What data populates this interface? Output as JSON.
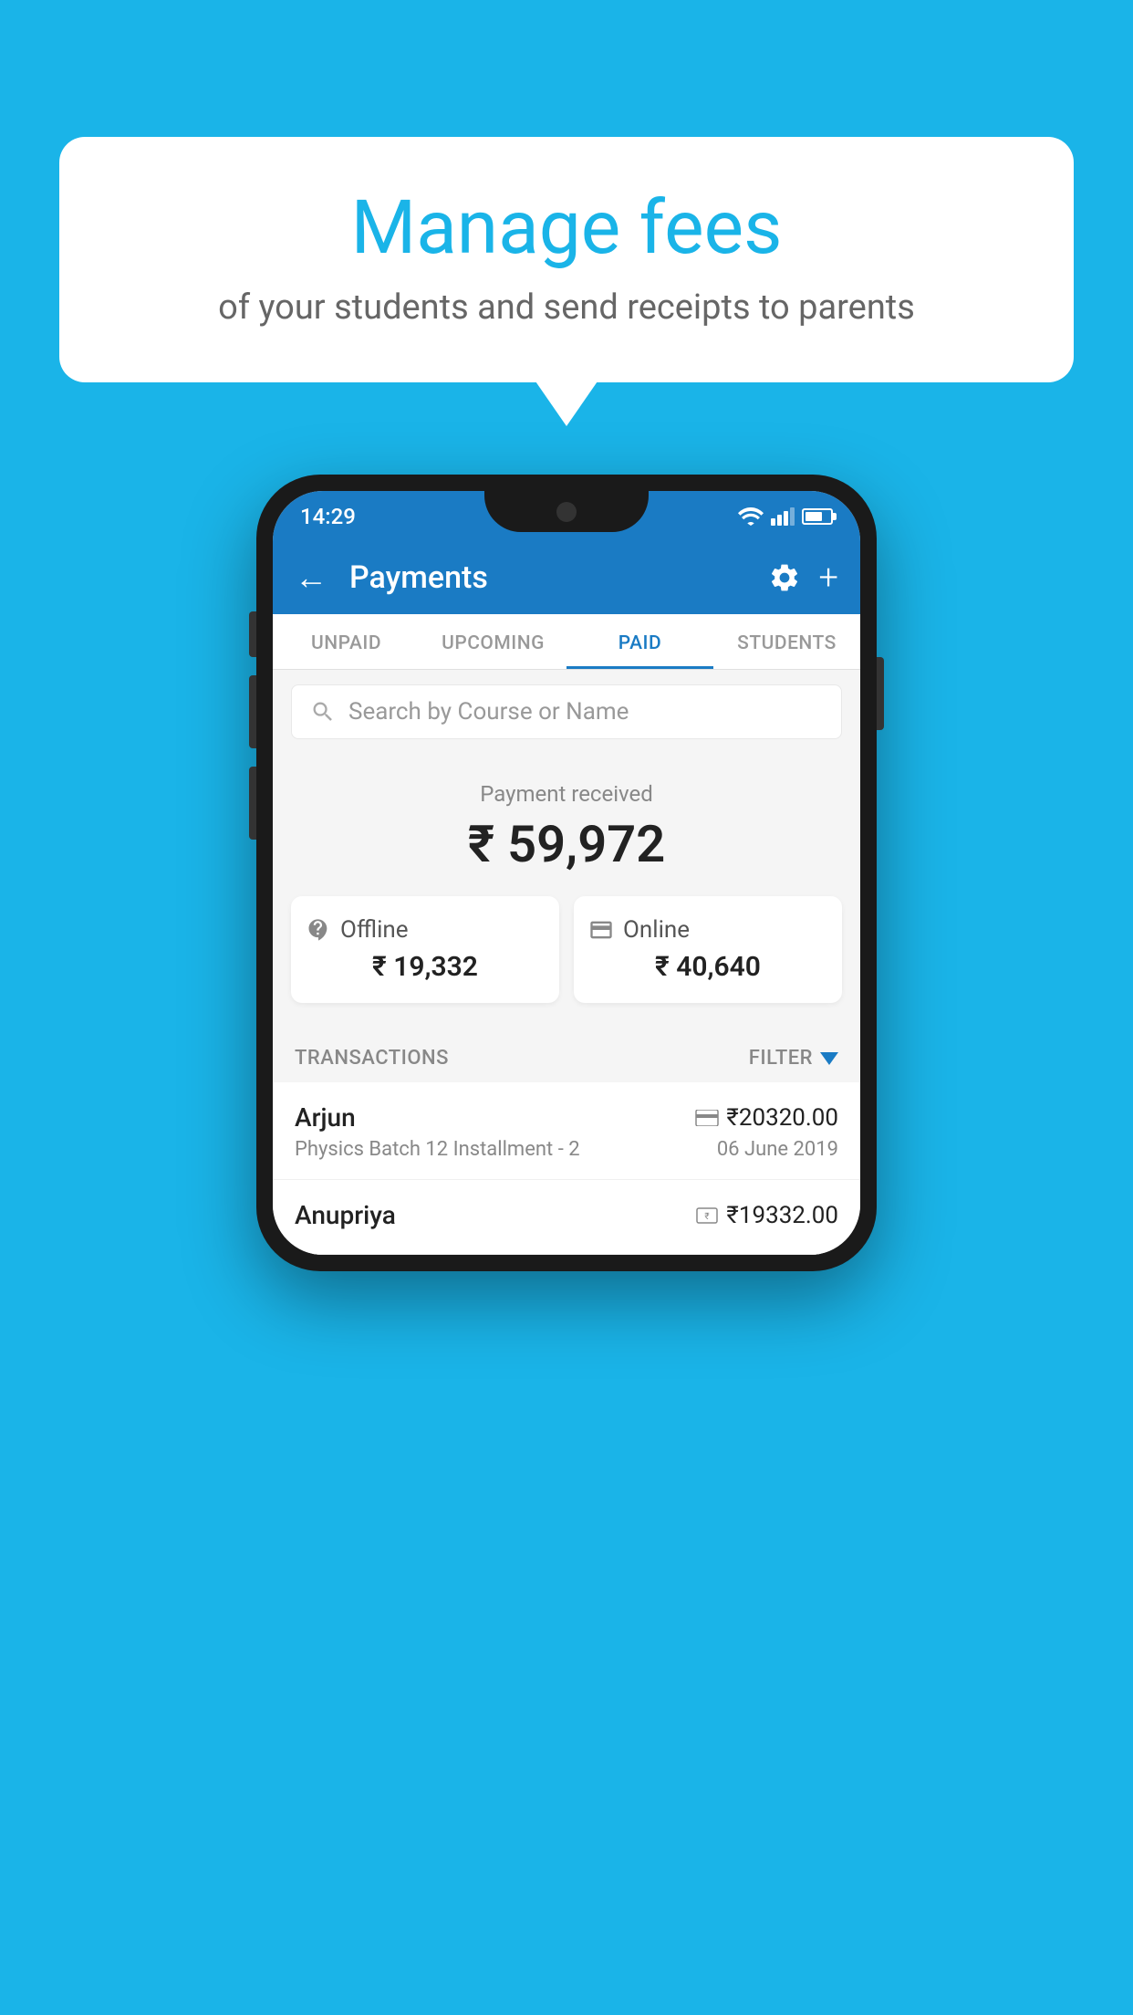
{
  "background_color": "#1ab4e8",
  "speech_bubble": {
    "title": "Manage fees",
    "subtitle": "of your students and send receipts to parents"
  },
  "status_bar": {
    "time": "14:29"
  },
  "app_bar": {
    "title": "Payments",
    "back_label": "←",
    "settings_label": "⚙",
    "add_label": "+"
  },
  "tabs": [
    {
      "label": "UNPAID",
      "active": false
    },
    {
      "label": "UPCOMING",
      "active": false
    },
    {
      "label": "PAID",
      "active": true
    },
    {
      "label": "STUDENTS",
      "active": false
    }
  ],
  "search": {
    "placeholder": "Search by Course or Name"
  },
  "payment_received": {
    "label": "Payment received",
    "total": "₹ 59,972",
    "offline_label": "Offline",
    "offline_amount": "₹ 19,332",
    "online_label": "Online",
    "online_amount": "₹ 40,640"
  },
  "transactions": {
    "label": "TRANSACTIONS",
    "filter_label": "FILTER",
    "rows": [
      {
        "name": "Arjun",
        "amount": "₹20320.00",
        "course": "Physics Batch 12 Installment - 2",
        "date": "06 June 2019",
        "payment_type": "card"
      },
      {
        "name": "Anupriya",
        "amount": "₹19332.00",
        "course": "",
        "date": "",
        "payment_type": "cash"
      }
    ]
  }
}
